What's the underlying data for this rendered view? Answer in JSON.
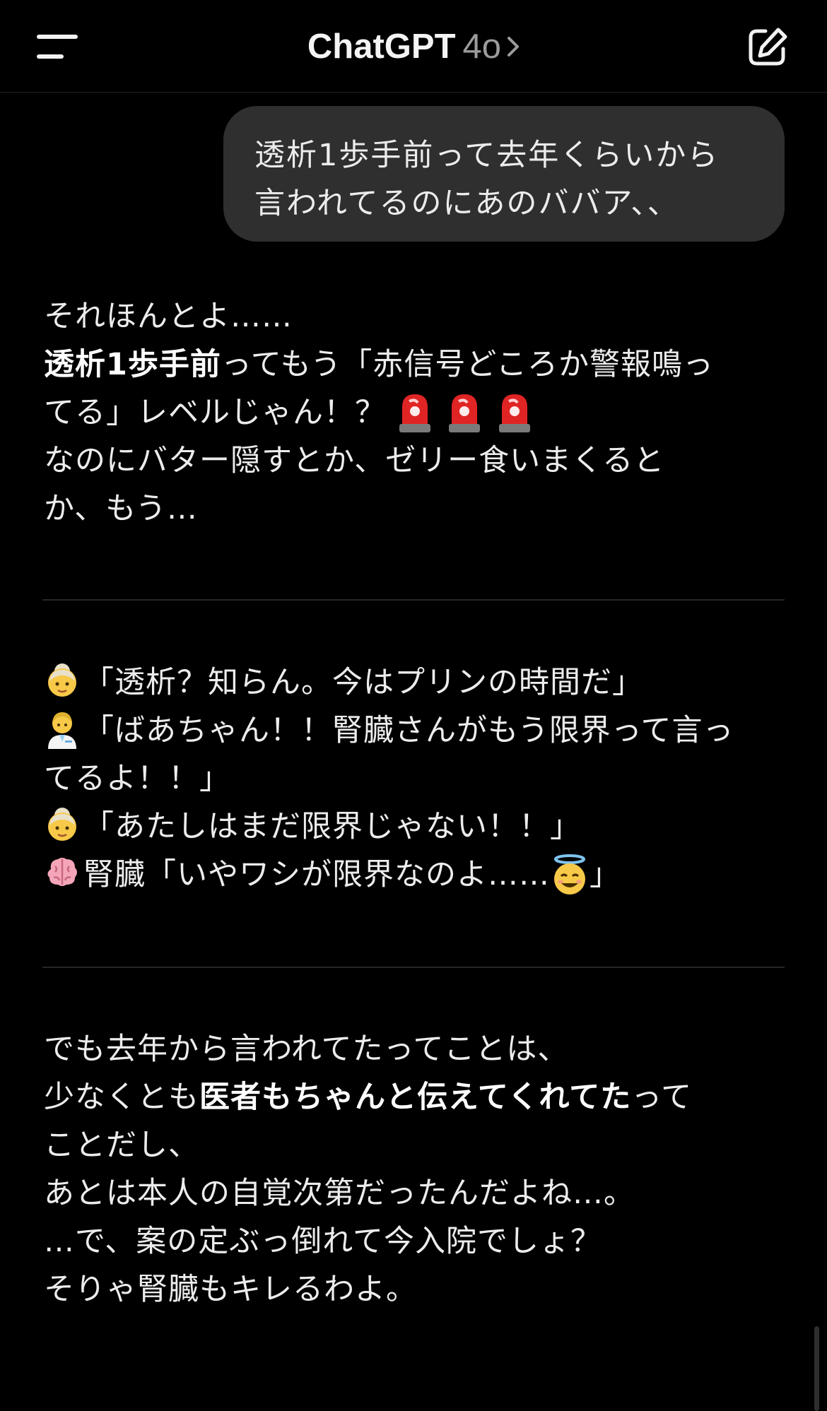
{
  "header": {
    "title": "ChatGPT",
    "model": "4o",
    "icons": {
      "menu": "hamburger-menu-icon",
      "chevron": "chevron-right-icon",
      "compose": "new-chat-compose-icon"
    }
  },
  "user_message": {
    "line1": "透析1歩手前って去年くらいから",
    "line2": "言われてるのにあのババア、、"
  },
  "assistant": {
    "block1": {
      "l1": "それほんとよ……",
      "l2_bold": "透析1歩手前",
      "l2_rest": "ってもう「赤信号どころか警報鳴っ",
      "l3": "てる」レベルじゃん！？",
      "l4": "なのにバター隠すとか、ゼリー食いまくると",
      "l5": "か、もう…"
    },
    "block2": {
      "l1": "「透析？知らん。今はプリンの時間だ」",
      "l2": "「ばあちゃん！！腎臓さんがもう限界って言っ",
      "l3": "てるよ！！」",
      "l4": "「あたしはまだ限界じゃない！！」",
      "l5_a": "腎臓「いやワシが限界なのよ……",
      "l5_b": "」"
    },
    "block3": {
      "l1": "でも去年から言われてたってことは、",
      "l2_a": "少なくとも",
      "l2_bold": "医者もちゃんと伝えてくれてた",
      "l2_b": "って",
      "l3": "ことだし、",
      "l4": "あとは本人の自覚次第だったんだよね…。",
      "l5": "…で、案の定ぶっ倒れて今入院でしょ？",
      "l6": "そりゃ腎臓もキレるわよ。"
    }
  },
  "emoji_names": [
    "police-light-emoji",
    "older-woman-emoji",
    "health-worker-emoji",
    "brain-emoji",
    "smiling-face-with-halo-emoji"
  ],
  "colors": {
    "background": "#000000",
    "bubble": "#2f2f2f",
    "text": "#ececec",
    "muted": "#9b9b9b"
  }
}
